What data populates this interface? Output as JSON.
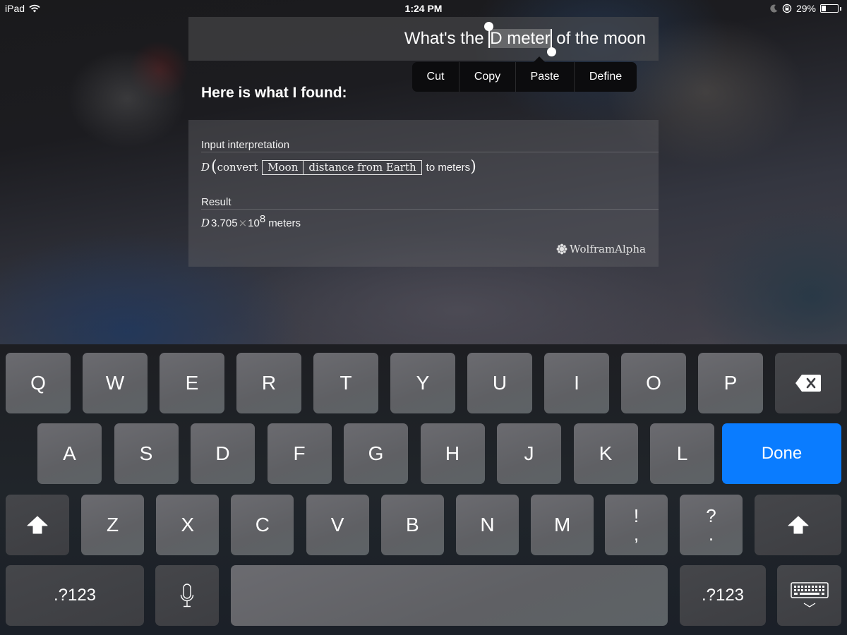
{
  "status_bar": {
    "device": "iPad",
    "time": "1:24 PM",
    "battery_percent": "29%",
    "battery_level": 0.29,
    "icons": [
      "wifi-icon",
      "moon-icon",
      "rotation-lock-icon",
      "battery-icon"
    ]
  },
  "query": {
    "before": "What's the ",
    "selected": "D meter",
    "after": " of the moon"
  },
  "edit_menu": {
    "items": [
      "Cut",
      "Copy",
      "Paste",
      "Define"
    ]
  },
  "found_title": "Here is what I found:",
  "result_card": {
    "input_label": "Input interpretation",
    "input": {
      "var": "D",
      "convert": "convert",
      "entity": "Moon",
      "property": "distance from Earth",
      "to": "to meters"
    },
    "result_label": "Result",
    "result": {
      "var": "D",
      "mantissa": "3.705",
      "times": "×",
      "base": "10",
      "exponent": "8",
      "unit": "meters"
    },
    "attribution": "WolframAlpha"
  },
  "keyboard": {
    "row1": [
      "Q",
      "W",
      "E",
      "R",
      "T",
      "Y",
      "U",
      "I",
      "O",
      "P"
    ],
    "row2": [
      "A",
      "S",
      "D",
      "F",
      "G",
      "H",
      "J",
      "K",
      "L"
    ],
    "row3": [
      "Z",
      "X",
      "C",
      "V",
      "B",
      "N",
      "M"
    ],
    "punct1": {
      "top": "!",
      "bottom": ","
    },
    "punct2": {
      "top": "?",
      "bottom": "."
    },
    "done": "Done",
    "numbers": ".?123",
    "accent_color": "#0a7cff"
  }
}
